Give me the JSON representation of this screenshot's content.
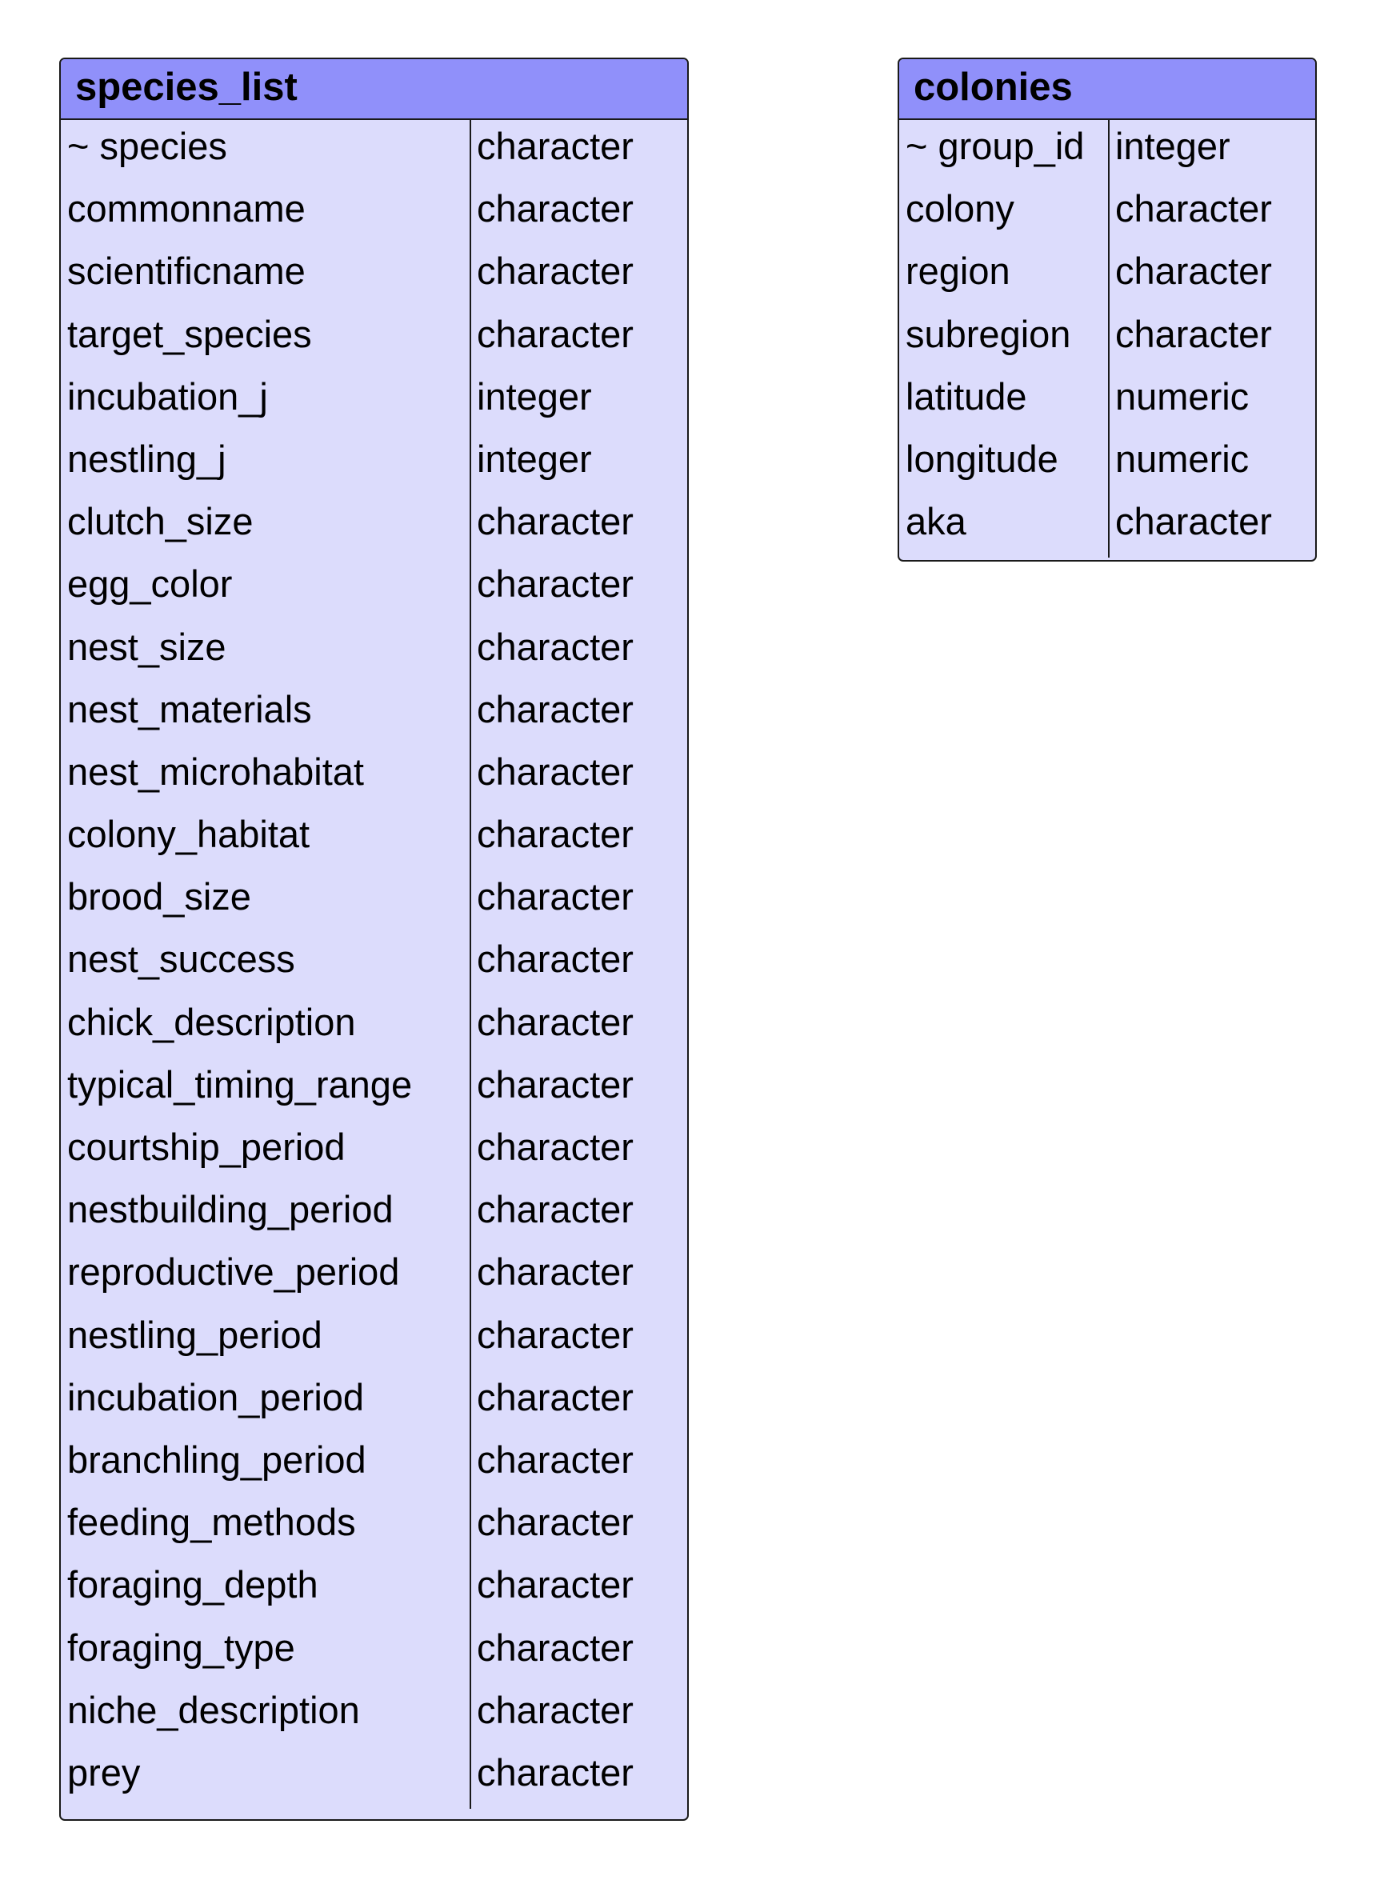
{
  "tables": [
    {
      "name": "species_list",
      "columns": [
        {
          "name": "~ species",
          "type": "character"
        },
        {
          "name": "commonname",
          "type": "character"
        },
        {
          "name": "scientificname",
          "type": "character"
        },
        {
          "name": "target_species",
          "type": "character"
        },
        {
          "name": "incubation_j",
          "type": "integer"
        },
        {
          "name": "nestling_j",
          "type": "integer"
        },
        {
          "name": "clutch_size",
          "type": "character"
        },
        {
          "name": "egg_color",
          "type": "character"
        },
        {
          "name": "nest_size",
          "type": "character"
        },
        {
          "name": "nest_materials",
          "type": "character"
        },
        {
          "name": "nest_microhabitat",
          "type": "character"
        },
        {
          "name": "colony_habitat",
          "type": "character"
        },
        {
          "name": "brood_size",
          "type": "character"
        },
        {
          "name": "nest_success",
          "type": "character"
        },
        {
          "name": "chick_description",
          "type": "character"
        },
        {
          "name": "typical_timing_range",
          "type": "character"
        },
        {
          "name": "courtship_period",
          "type": "character"
        },
        {
          "name": "nestbuilding_period",
          "type": "character"
        },
        {
          "name": "reproductive_period",
          "type": "character"
        },
        {
          "name": "nestling_period",
          "type": "character"
        },
        {
          "name": "incubation_period",
          "type": "character"
        },
        {
          "name": "branchling_period",
          "type": "character"
        },
        {
          "name": "feeding_methods",
          "type": "character"
        },
        {
          "name": "foraging_depth",
          "type": "character"
        },
        {
          "name": "foraging_type",
          "type": "character"
        },
        {
          "name": "niche_description",
          "type": "character"
        },
        {
          "name": "prey",
          "type": "character"
        }
      ]
    },
    {
      "name": "colonies",
      "columns": [
        {
          "name": "~ group_id",
          "type": "integer"
        },
        {
          "name": "colony",
          "type": "character"
        },
        {
          "name": "region",
          "type": "character"
        },
        {
          "name": "subregion",
          "type": "character"
        },
        {
          "name": "latitude",
          "type": "numeric"
        },
        {
          "name": "longitude",
          "type": "numeric"
        },
        {
          "name": "aka",
          "type": "character"
        }
      ]
    }
  ],
  "colors": {
    "header": "#9090fa",
    "body": "#dcdcfc",
    "border": "#1a1a1a"
  }
}
